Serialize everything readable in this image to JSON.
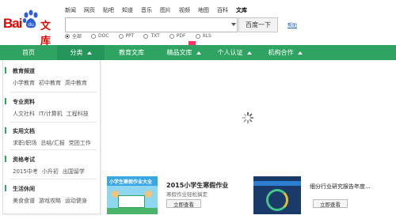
{
  "logo": {
    "bai": "Bai",
    "paw": "du",
    "wenku": "文库"
  },
  "topnav": [
    "新闻",
    "网页",
    "贴吧",
    "知道",
    "音乐",
    "图片",
    "视频",
    "地图",
    "百科",
    "文库"
  ],
  "search": {
    "value": "",
    "button": "百度一下",
    "help": "帮助"
  },
  "filetypes": [
    {
      "label": "全部",
      "checked": true
    },
    {
      "label": "DOC",
      "checked": false
    },
    {
      "label": "PPT",
      "checked": false
    },
    {
      "label": "TXT",
      "checked": false
    },
    {
      "label": "PDF",
      "checked": false
    },
    {
      "label": "XLS",
      "checked": false
    }
  ],
  "mainnav": [
    "首页",
    "分类",
    "教育文库",
    "精品文库",
    "个人认证",
    "机构合作"
  ],
  "sidebar": [
    {
      "title": "教育频道",
      "links": [
        "小学教育",
        "初中教育",
        "高中教育"
      ]
    },
    {
      "title": "专业资料",
      "links": [
        "人文社科",
        "IT/计算机",
        "工程科技"
      ]
    },
    {
      "title": "实用文档",
      "links": [
        "求职/职场",
        "总结/汇报",
        "党团工作"
      ]
    },
    {
      "title": "资格考试",
      "links": [
        "2015中考",
        "小升初",
        "出国留学"
      ]
    },
    {
      "title": "生活休闲",
      "links": [
        "美食食谱",
        "游戏攻略",
        "运动健身"
      ]
    }
  ],
  "promos": [
    {
      "image_text": "小学生寒假作业大全",
      "title": "2015小学生寒假作业",
      "subtitle": "寒假作业轻松搞定",
      "button": "立即查看"
    },
    {
      "title": "细分行业研究报告年度...",
      "subtitle": "",
      "button": "立即查看"
    }
  ],
  "colors": {
    "brand_red": "#e10601",
    "nav_green": "#2fa462"
  }
}
